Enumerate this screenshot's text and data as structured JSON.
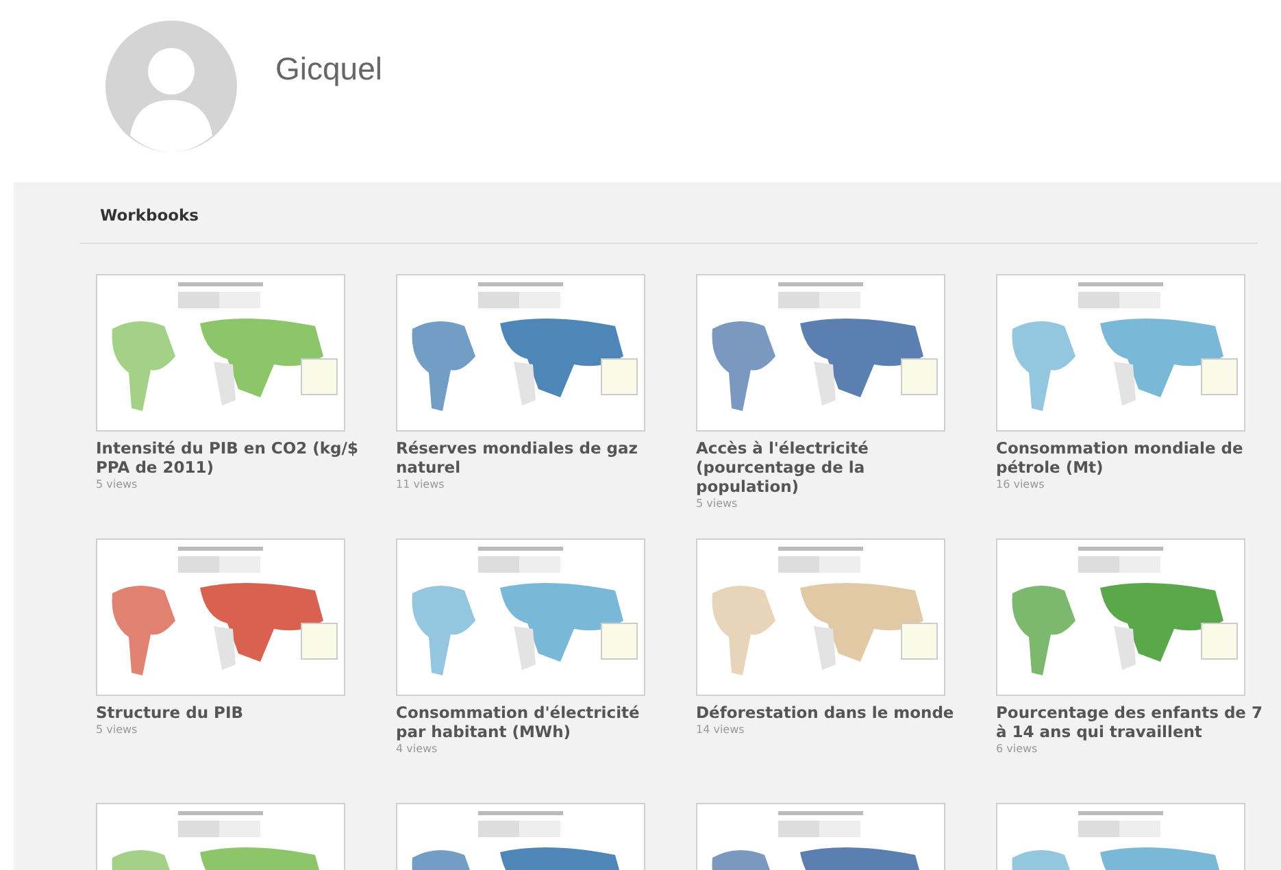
{
  "profile": {
    "name": "Gicquel"
  },
  "section": {
    "title": "Workbooks"
  },
  "workbooks": [
    {
      "kind": "full",
      "title": "Intensité du PIB en CO2 (kg/$ PPA de 2011)",
      "views": "5 views"
    },
    {
      "kind": "full",
      "title": "Réserves mondiales de gaz naturel",
      "views": "11 views"
    },
    {
      "kind": "full",
      "title": "Accès à l'électricité (pourcentage de la population)",
      "views": "5 views"
    },
    {
      "kind": "full",
      "title": "Consommation mondiale de pétrole (Mt)",
      "views": "16 views"
    },
    {
      "kind": "full",
      "title": "Structure du PIB",
      "views": "5 views"
    },
    {
      "kind": "full",
      "title": "Consommation d'électricité par habitant (MWh)",
      "views": "4 views"
    },
    {
      "kind": "full",
      "title": "Déforestation dans le monde",
      "views": "14 views"
    },
    {
      "kind": "full",
      "title": "Pourcentage des enfants de 7 à 14 ans qui travaillent",
      "views": "6 views"
    },
    {
      "kind": "cut"
    },
    {
      "kind": "cut"
    },
    {
      "kind": "cut"
    },
    {
      "kind": "cut"
    }
  ]
}
